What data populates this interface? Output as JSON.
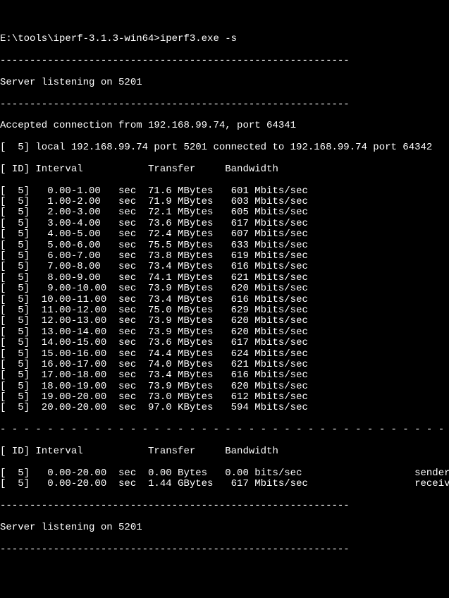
{
  "prompt": "E:\\tools\\iperf-3.1.3-win64>iperf3.exe -s",
  "listen1": "Server listening on 5201",
  "accepted": "Accepted connection from 192.168.99.74, port 64341",
  "local": "[  5] local 192.168.99.74 port 5201 connected to 192.168.99.74 port 64342",
  "header": "[ ID] Interval           Transfer     Bandwidth",
  "rows": [
    {
      "id": "[  5]",
      "interval": "   0.00-1.00 ",
      "unit": "  sec",
      "transfer": "  71.6 MBytes",
      "bw": "   601 Mbits/sec"
    },
    {
      "id": "[  5]",
      "interval": "   1.00-2.00 ",
      "unit": "  sec",
      "transfer": "  71.9 MBytes",
      "bw": "   603 Mbits/sec"
    },
    {
      "id": "[  5]",
      "interval": "   2.00-3.00 ",
      "unit": "  sec",
      "transfer": "  72.1 MBytes",
      "bw": "   605 Mbits/sec"
    },
    {
      "id": "[  5]",
      "interval": "   3.00-4.00 ",
      "unit": "  sec",
      "transfer": "  73.6 MBytes",
      "bw": "   617 Mbits/sec"
    },
    {
      "id": "[  5]",
      "interval": "   4.00-5.00 ",
      "unit": "  sec",
      "transfer": "  72.4 MBytes",
      "bw": "   607 Mbits/sec"
    },
    {
      "id": "[  5]",
      "interval": "   5.00-6.00 ",
      "unit": "  sec",
      "transfer": "  75.5 MBytes",
      "bw": "   633 Mbits/sec"
    },
    {
      "id": "[  5]",
      "interval": "   6.00-7.00 ",
      "unit": "  sec",
      "transfer": "  73.8 MBytes",
      "bw": "   619 Mbits/sec"
    },
    {
      "id": "[  5]",
      "interval": "   7.00-8.00 ",
      "unit": "  sec",
      "transfer": "  73.4 MBytes",
      "bw": "   616 Mbits/sec"
    },
    {
      "id": "[  5]",
      "interval": "   8.00-9.00 ",
      "unit": "  sec",
      "transfer": "  74.1 MBytes",
      "bw": "   621 Mbits/sec"
    },
    {
      "id": "[  5]",
      "interval": "   9.00-10.00",
      "unit": "  sec",
      "transfer": "  73.9 MBytes",
      "bw": "   620 Mbits/sec"
    },
    {
      "id": "[  5]",
      "interval": "  10.00-11.00",
      "unit": "  sec",
      "transfer": "  73.4 MBytes",
      "bw": "   616 Mbits/sec"
    },
    {
      "id": "[  5]",
      "interval": "  11.00-12.00",
      "unit": "  sec",
      "transfer": "  75.0 MBytes",
      "bw": "   629 Mbits/sec"
    },
    {
      "id": "[  5]",
      "interval": "  12.00-13.00",
      "unit": "  sec",
      "transfer": "  73.9 MBytes",
      "bw": "   620 Mbits/sec"
    },
    {
      "id": "[  5]",
      "interval": "  13.00-14.00",
      "unit": "  sec",
      "transfer": "  73.9 MBytes",
      "bw": "   620 Mbits/sec"
    },
    {
      "id": "[  5]",
      "interval": "  14.00-15.00",
      "unit": "  sec",
      "transfer": "  73.6 MBytes",
      "bw": "   617 Mbits/sec"
    },
    {
      "id": "[  5]",
      "interval": "  15.00-16.00",
      "unit": "  sec",
      "transfer": "  74.4 MBytes",
      "bw": "   624 Mbits/sec"
    },
    {
      "id": "[  5]",
      "interval": "  16.00-17.00",
      "unit": "  sec",
      "transfer": "  74.0 MBytes",
      "bw": "   621 Mbits/sec"
    },
    {
      "id": "[  5]",
      "interval": "  17.00-18.00",
      "unit": "  sec",
      "transfer": "  73.4 MBytes",
      "bw": "   616 Mbits/sec"
    },
    {
      "id": "[  5]",
      "interval": "  18.00-19.00",
      "unit": "  sec",
      "transfer": "  73.9 MBytes",
      "bw": "   620 Mbits/sec"
    },
    {
      "id": "[  5]",
      "interval": "  19.00-20.00",
      "unit": "  sec",
      "transfer": "  73.0 MBytes",
      "bw": "   612 Mbits/sec"
    },
    {
      "id": "[  5]",
      "interval": "  20.00-20.00",
      "unit": "  sec",
      "transfer": "  97.0 KBytes",
      "bw": "   594 Mbits/sec"
    }
  ],
  "summary": [
    {
      "id": "[  5]",
      "interval": "   0.00-20.00",
      "unit": "  sec",
      "transfer": "  0.00 Bytes ",
      "bw": "  0.00 bits/sec ",
      "role": "                  sender"
    },
    {
      "id": "[  5]",
      "interval": "   0.00-20.00",
      "unit": "  sec",
      "transfer": "  1.44 GBytes",
      "bw": "   617 Mbits/sec",
      "role": "                  receiver"
    }
  ],
  "listen2": "Server listening on 5201"
}
